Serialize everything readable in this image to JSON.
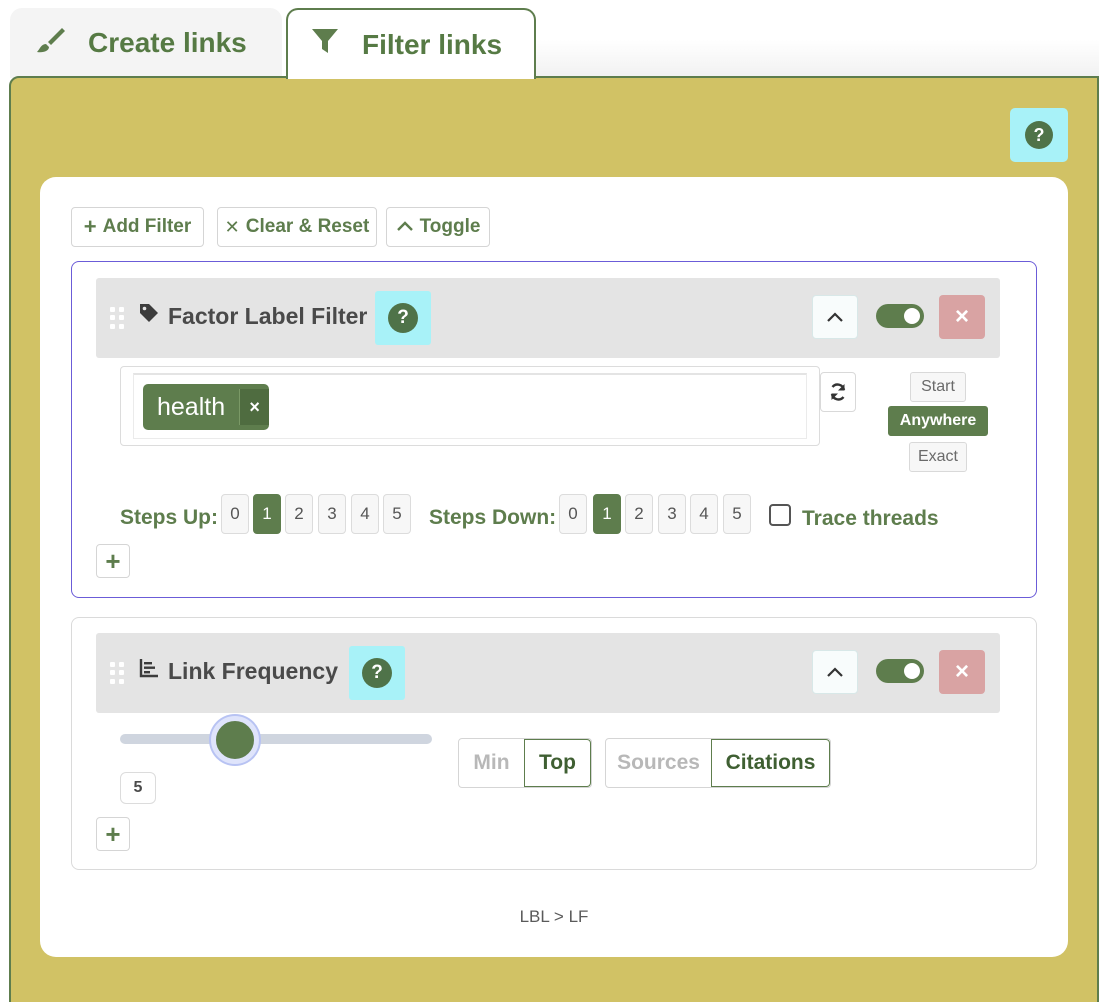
{
  "tabs": [
    {
      "label": "Create links",
      "icon": "brush-icon",
      "active": false
    },
    {
      "label": "Filter links",
      "icon": "filter-icon",
      "active": true
    }
  ],
  "help_label": "?",
  "toolbar": {
    "add_filter": "Add Filter",
    "clear_reset": "Clear & Reset",
    "toggle": "Toggle"
  },
  "factor_filter": {
    "title": "Factor Label Filter",
    "tag": "health",
    "tag_remove": "×",
    "match_modes": [
      "Start",
      "Anywhere",
      "Exact"
    ],
    "match_mode_selected": "Anywhere",
    "steps_up_label": "Steps Up:",
    "steps_down_label": "Steps Down:",
    "step_options": [
      "0",
      "1",
      "2",
      "3",
      "4",
      "5"
    ],
    "steps_up_selected": "1",
    "steps_down_selected": "1",
    "trace_threads_label": "Trace threads",
    "trace_threads_checked": false,
    "enabled": true
  },
  "link_frequency": {
    "title": "Link Frequency",
    "slider_value": "5",
    "mode_options": [
      "Min",
      "Top"
    ],
    "mode_selected": "Top",
    "count_options": [
      "Sources",
      "Citations"
    ],
    "count_selected": "Citations",
    "enabled": true
  },
  "close_label": "×",
  "breadcrumb": "LBL > LF",
  "colors": {
    "accent": "#5e7d4d",
    "panel": "#d1c265",
    "help_bg": "#a8f2f8",
    "delete_bg": "#d9a3a3"
  }
}
